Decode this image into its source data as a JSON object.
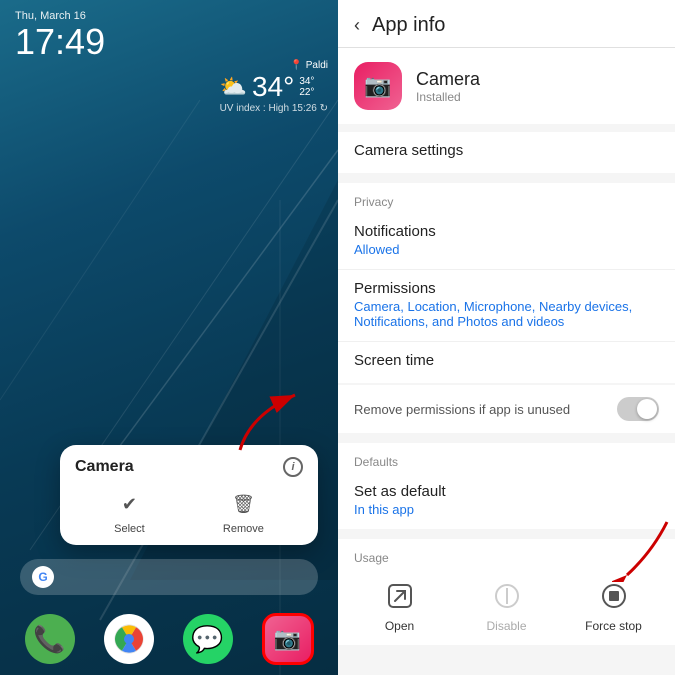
{
  "left": {
    "date": "Thu, March 16",
    "time": "17:49",
    "location": "Paldi",
    "weather_icon": "⛅",
    "temp": "34°",
    "temp_high": "34°",
    "temp_low": "22°",
    "uv": "UV index : High  15:26 ↻",
    "camera_popup_title": "Camera",
    "info_icon": "i",
    "action_select": "Select",
    "action_remove": "Remove",
    "google_letter": "G",
    "dock_icons": [
      "📞",
      "",
      "",
      "📷"
    ]
  },
  "right": {
    "back_label": "‹",
    "header_title": "App info",
    "app_name": "Camera",
    "app_status": "Installed",
    "camera_settings_label": "Camera settings",
    "privacy_label": "Privacy",
    "notifications_title": "Notifications",
    "notifications_sub": "Allowed",
    "permissions_title": "Permissions",
    "permissions_sub": "Camera, Location, Microphone, Nearby devices, Notifications, and Photos and videos",
    "screen_time_title": "Screen time",
    "remove_permissions_label": "Remove permissions if app is unused",
    "defaults_label": "Defaults",
    "set_as_default_title": "Set as default",
    "set_as_default_sub": "In this app",
    "usage_label": "Usage",
    "open_label": "Open",
    "disable_label": "Disable",
    "force_stop_label": "Force stop"
  }
}
